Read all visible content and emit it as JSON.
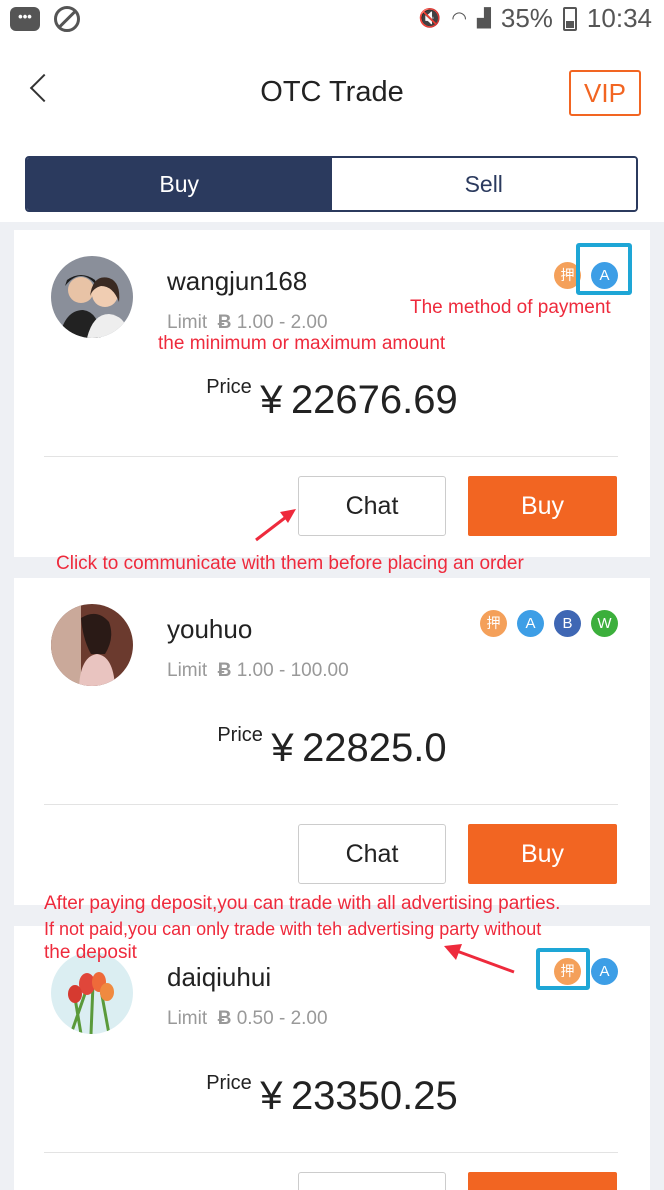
{
  "status": {
    "battery": "35%",
    "time": "10:34"
  },
  "nav": {
    "title": "OTC Trade",
    "vip_label": "VIP"
  },
  "tabs": [
    {
      "label": "Buy"
    },
    {
      "label": "Sell"
    }
  ],
  "currency_symbol": "¥",
  "coin_symbol": "Ƀ",
  "price_label": "Price",
  "limit_label": "Limit",
  "chat_label": "Chat",
  "buy_label": "Buy",
  "payment_glyphs": {
    "deposit": "押",
    "alipay": "A",
    "bank": "B",
    "wechat": "W"
  },
  "offers": [
    {
      "username": "wangjun168",
      "limit": "1.00 - 2.00",
      "price": "22676.69",
      "payment_methods": [
        "deposit",
        "alipay"
      ]
    },
    {
      "username": "youhuo",
      "limit": "1.00 - 100.00",
      "price": "22825.0",
      "payment_methods": [
        "deposit",
        "alipay",
        "bank",
        "wechat"
      ]
    },
    {
      "username": "daiqiuhui",
      "limit": "0.50 - 2.00",
      "price": "23350.25",
      "payment_methods": [
        "deposit",
        "alipay"
      ]
    }
  ],
  "annotations": {
    "payment_method": "The method of payment",
    "limit_amount": "the  minimum or maximum amount",
    "chat_hint": "Click to communicate with them before placing an order",
    "deposit_line1": "After paying deposit,you can trade with all advertising parties.",
    "deposit_line2": "If not paid,you can only trade with teh advertising party without",
    "deposit_line3": "the deposit"
  },
  "colors": {
    "accent": "#f26522",
    "tab_active": "#2b3a5e",
    "annotation": "#ee2a3c",
    "highlight": "#1ea6d6"
  }
}
